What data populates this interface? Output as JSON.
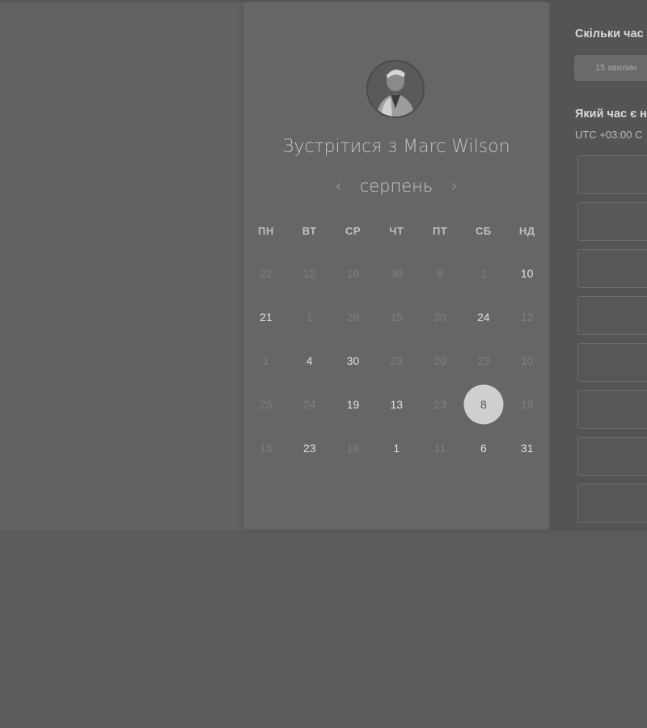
{
  "page_title": "Зустрітися з Marc Wilson",
  "calendar": {
    "month": "серпень",
    "prev_arrow": "‹",
    "next_arrow": "›",
    "weekdays": [
      "ПН",
      "ВТ",
      "СР",
      "ЧТ",
      "ПТ",
      "СБ",
      "НД"
    ],
    "weeks": [
      [
        {
          "d": "22",
          "s": "dim"
        },
        {
          "d": "12",
          "s": "dim"
        },
        {
          "d": "16",
          "s": "dim"
        },
        {
          "d": "30",
          "s": "dim"
        },
        {
          "d": "6",
          "s": "dim"
        },
        {
          "d": "1",
          "s": "dim"
        },
        {
          "d": "10",
          "s": "avail"
        }
      ],
      [
        {
          "d": "21",
          "s": "avail"
        },
        {
          "d": "1",
          "s": "dim"
        },
        {
          "d": "29",
          "s": "dim"
        },
        {
          "d": "15",
          "s": "dim"
        },
        {
          "d": "30",
          "s": "dim"
        },
        {
          "d": "24",
          "s": "avail"
        },
        {
          "d": "12",
          "s": "dim"
        }
      ],
      [
        {
          "d": "1",
          "s": "dim"
        },
        {
          "d": "4",
          "s": "avail"
        },
        {
          "d": "30",
          "s": "avail"
        },
        {
          "d": "23",
          "s": "dim"
        },
        {
          "d": "20",
          "s": "dim"
        },
        {
          "d": "23",
          "s": "dim"
        },
        {
          "d": "10",
          "s": "dim"
        }
      ],
      [
        {
          "d": "25",
          "s": "dim"
        },
        {
          "d": "24",
          "s": "dim"
        },
        {
          "d": "19",
          "s": "avail"
        },
        {
          "d": "13",
          "s": "avail"
        },
        {
          "d": "23",
          "s": "dim"
        },
        {
          "d": "8",
          "s": "selected"
        },
        {
          "d": "18",
          "s": "dim"
        }
      ],
      [
        {
          "d": "15",
          "s": "dim"
        },
        {
          "d": "23",
          "s": "avail"
        },
        {
          "d": "18",
          "s": "dim"
        },
        {
          "d": "1",
          "s": "avail"
        },
        {
          "d": "11",
          "s": "dim"
        },
        {
          "d": "6",
          "s": "avail"
        },
        {
          "d": "31",
          "s": "avail"
        }
      ]
    ]
  },
  "booking": {
    "duration_question": "Скільки час",
    "duration_option": "15 хвилин",
    "time_question": "Який час є н",
    "timezone": "UTC +03:00 С",
    "slots_visible": 8
  },
  "colors": {
    "overlay": "#626262",
    "left_panel": "#666666",
    "right_panel": "#545454",
    "selected_day": "#cfcfcf"
  }
}
